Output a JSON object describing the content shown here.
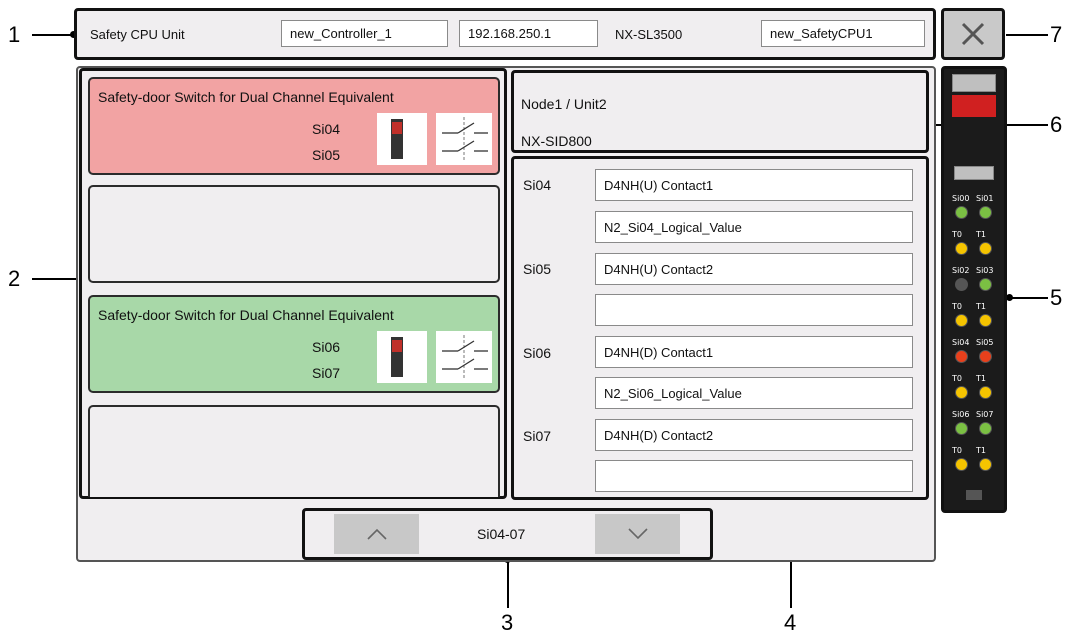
{
  "callouts": {
    "c1": "1",
    "c2": "2",
    "c3": "3",
    "c4": "4",
    "c5": "5",
    "c6": "6",
    "c7": "7"
  },
  "topbar": {
    "label": "Safety CPU Unit",
    "controller": "new_Controller_1",
    "ip": "192.168.250.1",
    "model": "NX-SL3500",
    "cpu_name": "new_SafetyCPU1"
  },
  "cards": [
    {
      "title": "Safety-door Switch for Dual Channel Equivalent",
      "si_a": "Si04",
      "si_b": "Si05",
      "color": "#f2a3a3"
    },
    {
      "title": "",
      "si_a": "",
      "si_b": "",
      "color": "#f0eef0"
    },
    {
      "title": "Safety-door Switch for Dual Channel Equivalent",
      "si_a": "Si06",
      "si_b": "Si07",
      "color": "#a8d8a8"
    },
    {
      "title": "",
      "si_a": "",
      "si_b": "",
      "color": "#f0eef0"
    }
  ],
  "node": {
    "line1": "Node1 / Unit2",
    "line2": "NX-SID800"
  },
  "io": [
    {
      "label": "Si04",
      "field1": "D4NH(U) Contact1",
      "field2": "N2_Si04_Logical_Value"
    },
    {
      "label": "Si05",
      "field1": "D4NH(U) Contact2",
      "field2": ""
    },
    {
      "label": "Si06",
      "field1": "D4NH(D) Contact1",
      "field2": "N2_Si06_Logical_Value"
    },
    {
      "label": "Si07",
      "field1": "D4NH(D) Contact2",
      "field2": ""
    }
  ],
  "nav": {
    "range": "Si04-07",
    "up_icon": "chevron-up-icon",
    "down_icon": "chevron-down-icon"
  },
  "close_icon": "close-icon",
  "unit_leds": {
    "rows": [
      {
        "labels": [
          "Si00",
          "Si01"
        ],
        "colors": [
          "#7bc043",
          "#7bc043"
        ]
      },
      {
        "labels": [
          "T0",
          "T1"
        ],
        "colors": [
          "#f5c400",
          "#f5c400"
        ]
      },
      {
        "labels": [
          "Si02",
          "Si03"
        ],
        "colors": [
          "#555555",
          "#7bc043"
        ]
      },
      {
        "labels": [
          "T0",
          "T1"
        ],
        "colors": [
          "#f5c400",
          "#f5c400"
        ]
      },
      {
        "labels": [
          "Si04",
          "Si05"
        ],
        "colors": [
          "#e8401c",
          "#e8401c"
        ]
      },
      {
        "labels": [
          "T0",
          "T1"
        ],
        "colors": [
          "#f5c400",
          "#f5c400"
        ]
      },
      {
        "labels": [
          "Si06",
          "Si07"
        ],
        "colors": [
          "#7bc043",
          "#7bc043"
        ]
      },
      {
        "labels": [
          "T0",
          "T1"
        ],
        "colors": [
          "#f5c400",
          "#f5c400"
        ]
      }
    ]
  }
}
